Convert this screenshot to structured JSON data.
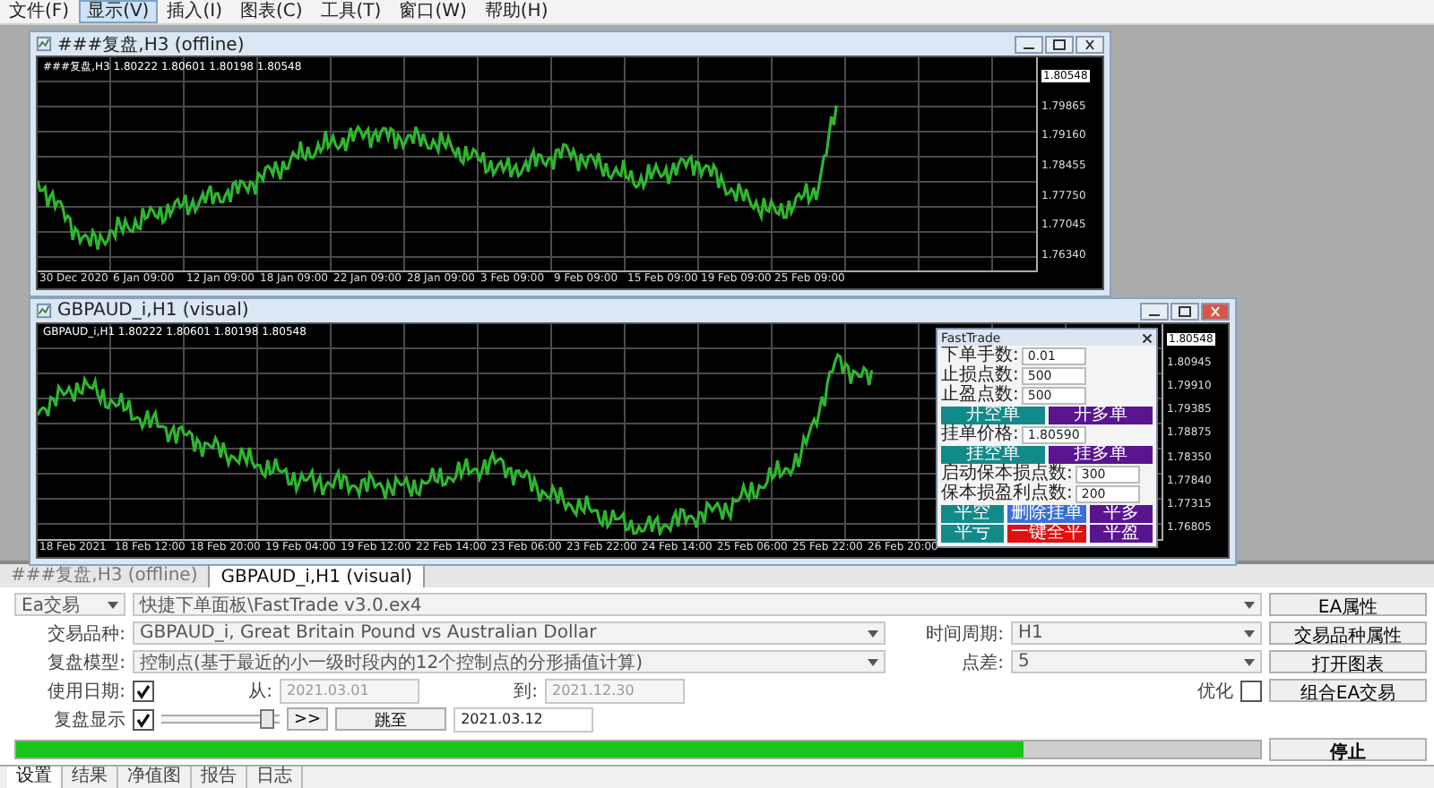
{
  "menu": [
    {
      "label": "文件(F)",
      "selected": false
    },
    {
      "label": "显示(V)",
      "selected": true
    },
    {
      "label": "插入(I)",
      "selected": false
    },
    {
      "label": "图表(C)",
      "selected": false
    },
    {
      "label": "工具(T)",
      "selected": false
    },
    {
      "label": "窗口(W)",
      "selected": false
    },
    {
      "label": "帮助(H)",
      "selected": false
    }
  ],
  "windows": [
    {
      "title": "###复盘,H3 (offline)",
      "chart_info": "###复盘,H3  1.80222 1.80601 1.80198 1.80548",
      "current_price": "1.80548",
      "price_labels": [
        "1.79865",
        "1.79160",
        "1.78455",
        "1.77750",
        "1.77045",
        "1.76340"
      ],
      "time_labels": [
        "30 Dec 2020",
        "6 Jan 09:00",
        "12 Jan 09:00",
        "18 Jan 09:00",
        "22 Jan 09:00",
        "28 Jan 09:00",
        "3 Feb 09:00",
        "9 Feb 09:00",
        "15 Feb 09:00",
        "19 Feb 09:00",
        "25 Feb 09:00"
      ]
    },
    {
      "title": "GBPAUD_i,H1 (visual)",
      "chart_info": "GBPAUD_i,H1  1.80222 1.80601 1.80198 1.80548",
      "current_price": "1.80548",
      "price_labels": [
        "1.80945",
        "1.79910",
        "1.79385",
        "1.78875",
        "1.78350",
        "1.77840",
        "1.77315",
        "1.76805"
      ],
      "time_labels": [
        "18 Feb 2021",
        "18 Feb 12:00",
        "18 Feb 20:00",
        "19 Feb 04:00",
        "19 Feb 12:00",
        "22 Feb 14:00",
        "23 Feb 06:00",
        "23 Feb 22:00",
        "24 Feb 14:00",
        "25 Feb 06:00",
        "25 Feb 22:00",
        "26 Feb 20:00"
      ]
    }
  ],
  "fasttrade": {
    "title": "FastTrade",
    "rows": [
      {
        "kind": "field",
        "label": "下单手数:",
        "value": "0.01"
      },
      {
        "kind": "field",
        "label": "止损点数:",
        "value": "500"
      },
      {
        "kind": "field",
        "label": "止盈点数:",
        "value": "500"
      },
      {
        "kind": "buttons",
        "buttons": [
          {
            "label": "开空单",
            "color": "#138a8a"
          },
          {
            "label": "开多单",
            "color": "#5a1490"
          }
        ]
      },
      {
        "kind": "field",
        "label": "挂单价格:",
        "value": "1.80590"
      },
      {
        "kind": "buttons",
        "buttons": [
          {
            "label": "挂空单",
            "color": "#138a8a"
          },
          {
            "label": "挂多单",
            "color": "#5a1490"
          }
        ]
      },
      {
        "kind": "field",
        "label": "启动保本损点数:",
        "value": "300"
      },
      {
        "kind": "field",
        "label": "保本损盈利点数:",
        "value": "200"
      },
      {
        "kind": "buttons",
        "buttons": [
          {
            "label": "平空",
            "color": "#138a8a"
          },
          {
            "label": "删除挂单",
            "color": "#3a6fd8"
          },
          {
            "label": "平多",
            "color": "#5a1490"
          }
        ]
      },
      {
        "kind": "buttons",
        "buttons": [
          {
            "label": "平亏",
            "color": "#138a8a"
          },
          {
            "label": "一键全平",
            "color": "#e01010"
          },
          {
            "label": "平盈",
            "color": "#5a1490"
          }
        ]
      }
    ]
  },
  "tester": {
    "tabs": [
      {
        "label": "###复盘,H3 (offline)",
        "selected": false
      },
      {
        "label": "GBPAUD_i,H1 (visual)",
        "selected": true
      }
    ],
    "mode": "Ea交易",
    "expert": "快捷下单面板\\FastTrade v3.0.ex4",
    "expert_button": "EA属性",
    "symbol_label": "交易品种:",
    "symbol": "GBPAUD_i, Great Britain Pound vs Australian Dollar",
    "period_label": "时间周期:",
    "period": "H1",
    "symbol_button": "交易品种属性",
    "model_label": "复盘模型:",
    "model": "控制点(基于最近的小一级时段内的12个控制点的分形插值计算)",
    "spread_label": "点差:",
    "spread": "5",
    "chart_button": "打开图表",
    "dates": {
      "label": "使用日期:",
      "checked": true,
      "from_label": "从:",
      "from": "2021.03.01",
      "to_label": "到:",
      "to": "2021.12.30"
    },
    "optimize": {
      "label": "优化",
      "checked": false
    },
    "start_button": "组合EA交易",
    "replay": {
      "label": "复盘显示",
      "checked": true,
      "level": 0.95,
      "skip": ">>",
      "jump": "跳至",
      "date": "2021.03.12"
    },
    "progress": {
      "level": 0.81
    },
    "stop_button": "停止",
    "bottom_tabs": [
      {
        "label": "设置",
        "selected": true
      },
      {
        "label": "结果",
        "selected": false
      },
      {
        "label": "净值图",
        "selected": false
      },
      {
        "label": "报告",
        "selected": false
      },
      {
        "label": "日志",
        "selected": false
      }
    ]
  }
}
